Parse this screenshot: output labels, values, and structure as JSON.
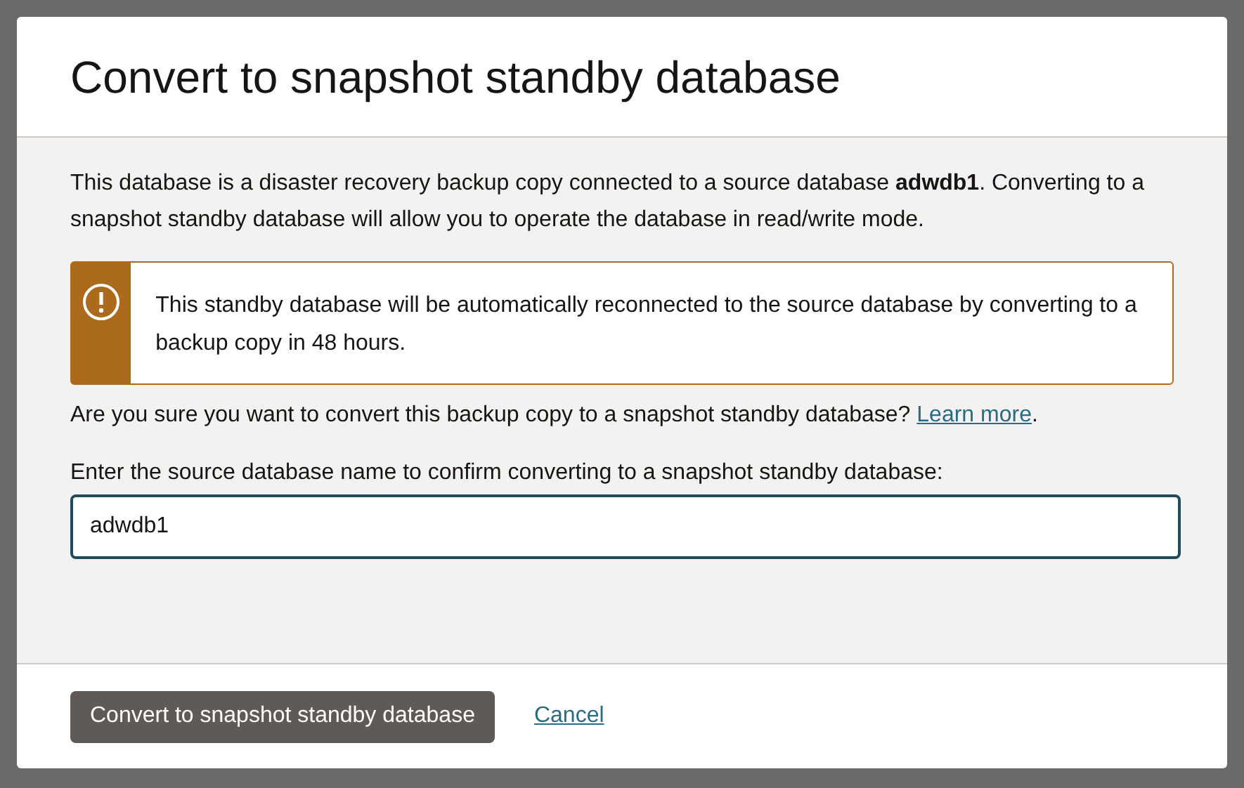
{
  "dialog": {
    "title": "Convert to snapshot standby database",
    "description": "This database is a disaster recovery backup copy connected to a source database **adwdb1**. Converting to a snapshot standby database will allow you to operate the database in read/write mode.",
    "warning": {
      "kind": "warning",
      "message": "This standby database will be automatically reconnected to the source database by converting to a backup copy in 48 hours."
    },
    "question": "Are you sure you want to convert this backup copy to a snapshot standby database?",
    "learn_more_link": "Learn more",
    "question_end": ".",
    "confirm_label": "Enter the source database name to confirm converting to a snapshot standby database:",
    "confirm_field": {
      "value": "adwdb1",
      "focused": true
    },
    "buttons": [
      {
        "kind": "primary",
        "label": "Convert to snapshot standby database"
      },
      {
        "kind": "link",
        "label": "Cancel"
      }
    ]
  }
}
